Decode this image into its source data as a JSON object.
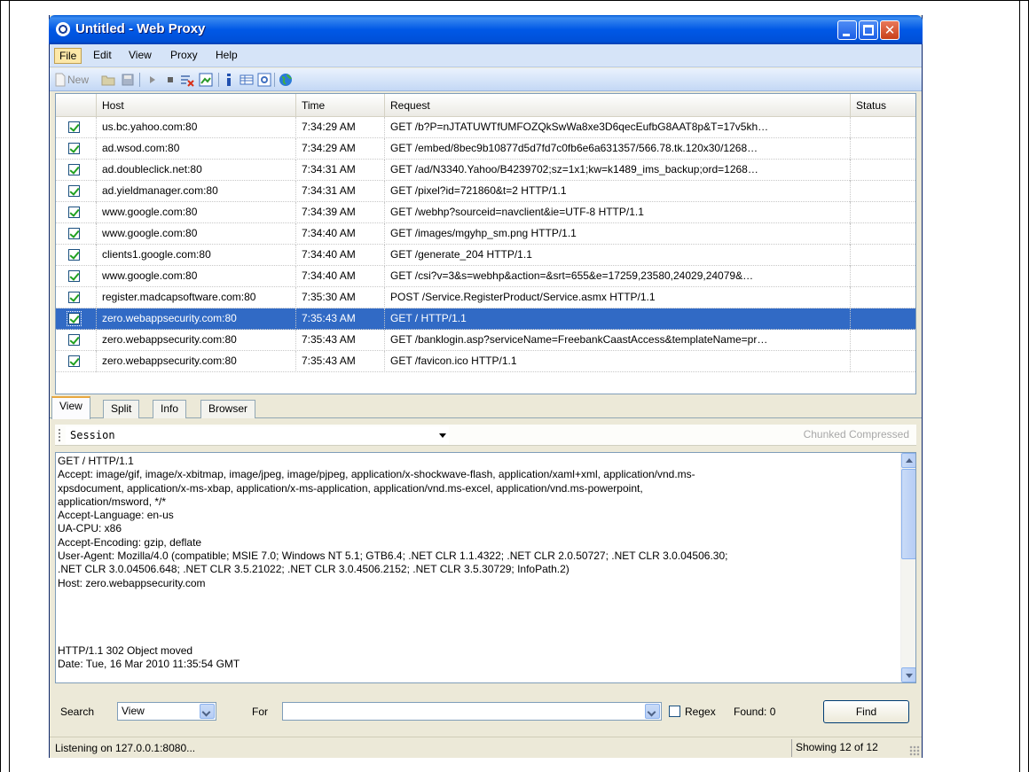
{
  "window": {
    "title": "Untitled - Web Proxy"
  },
  "menu": [
    "File",
    "Edit",
    "View",
    "Proxy",
    "Help"
  ],
  "toolbar": {
    "new_label": "New",
    "icons": [
      "new-icon",
      "open-icon",
      "save-icon",
      "play-icon",
      "stop-icon",
      "clear-icon",
      "capture-icon",
      "info-icon",
      "table-icon",
      "preview-icon",
      "globe-icon"
    ]
  },
  "grid": {
    "headers": [
      "Host",
      "Time",
      "Request",
      "Status"
    ],
    "rows": [
      {
        "host": "us.bc.yahoo.com:80",
        "time": "7:34:29 AM",
        "request": "GET /b?P=nJTATUWTfUMFOZQkSwWa8xe3D6qecEufbG8AAT8p&T=17v5kh…",
        "status": ""
      },
      {
        "host": "ad.wsod.com:80",
        "time": "7:34:29 AM",
        "request": "GET /embed/8bec9b10877d5d7fd7c0fb6e6a631357/566.78.tk.120x30/1268…",
        "status": ""
      },
      {
        "host": "ad.doubleclick.net:80",
        "time": "7:34:31 AM",
        "request": "GET /ad/N3340.Yahoo/B4239702;sz=1x1;kw=k1489_ims_backup;ord=1268…",
        "status": ""
      },
      {
        "host": "ad.yieldmanager.com:80",
        "time": "7:34:31 AM",
        "request": "GET /pixel?id=721860&t=2 HTTP/1.1",
        "status": ""
      },
      {
        "host": "www.google.com:80",
        "time": "7:34:39 AM",
        "request": "GET /webhp?sourceid=navclient&ie=UTF-8 HTTP/1.1",
        "status": ""
      },
      {
        "host": "www.google.com:80",
        "time": "7:34:40 AM",
        "request": "GET /images/mgyhp_sm.png HTTP/1.1",
        "status": ""
      },
      {
        "host": "clients1.google.com:80",
        "time": "7:34:40 AM",
        "request": "GET /generate_204 HTTP/1.1",
        "status": ""
      },
      {
        "host": "www.google.com:80",
        "time": "7:34:40 AM",
        "request": "GET /csi?v=3&s=webhp&action=&srt=655&e=17259,23580,24029,24079&…",
        "status": ""
      },
      {
        "host": "register.madcapsoftware.com:80",
        "time": "7:35:30 AM",
        "request": "POST /Service.RegisterProduct/Service.asmx HTTP/1.1",
        "status": ""
      },
      {
        "host": "zero.webappsecurity.com:80",
        "time": "7:35:43 AM",
        "request": "GET / HTTP/1.1",
        "status": "",
        "selected": true
      },
      {
        "host": "zero.webappsecurity.com:80",
        "time": "7:35:43 AM",
        "request": "GET /banklogin.asp?serviceName=FreebankCaastAccess&templateName=pr…",
        "status": ""
      },
      {
        "host": "zero.webappsecurity.com:80",
        "time": "7:35:43 AM",
        "request": "GET /favicon.ico HTTP/1.1",
        "status": ""
      }
    ]
  },
  "tabs": [
    "View",
    "Split",
    "Info",
    "Browser"
  ],
  "session": {
    "selected": "Session",
    "options_text": "Chunked  Compressed"
  },
  "textview": {
    "content": "GET / HTTP/1.1\nAccept: image/gif, image/x-xbitmap, image/jpeg, image/pjpeg, application/x-shockwave-flash, application/xaml+xml, application/vnd.ms-\nxpsdocument, application/x-ms-xbap, application/x-ms-application, application/vnd.ms-excel, application/vnd.ms-powerpoint,\napplication/msword, */*\nAccept-Language: en-us\nUA-CPU: x86\nAccept-Encoding: gzip, deflate\nUser-Agent: Mozilla/4.0 (compatible; MSIE 7.0; Windows NT 5.1; GTB6.4; .NET CLR 1.1.4322; .NET CLR 2.0.50727; .NET CLR 3.0.04506.30;\n.NET CLR 3.0.04506.648; .NET CLR 3.5.21022; .NET CLR 3.0.4506.2152; .NET CLR 3.5.30729; InfoPath.2)\nHost: zero.webappsecurity.com\n\n\n\n\nHTTP/1.1 302 Object moved\nDate: Tue, 16 Mar 2010 11:35:54 GMT"
  },
  "search": {
    "search_label": "Search",
    "scope_value": "View",
    "for_label": "For",
    "for_value": "",
    "regex_label": "Regex",
    "found_text": "Found: 0",
    "find_label": "Find"
  },
  "status": {
    "left": "Listening on 127.0.0.1:8080...",
    "right": "Showing 12 of 12"
  }
}
